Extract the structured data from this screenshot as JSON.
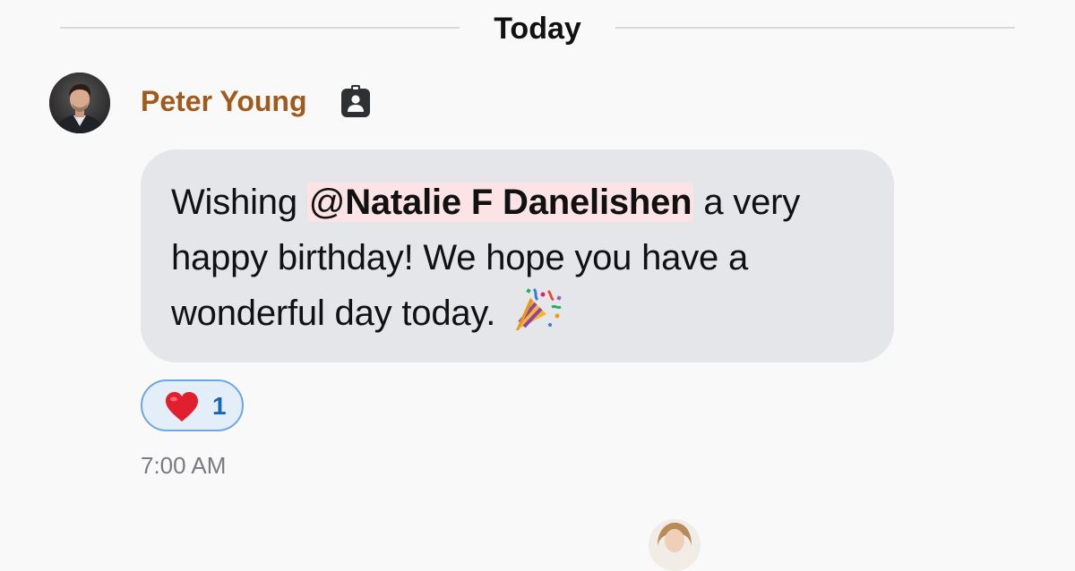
{
  "divider": {
    "label": "Today"
  },
  "message": {
    "sender": "Peter Young",
    "avatar_icon": "user-avatar",
    "badge_icon": "contact-card-icon",
    "text_before": "Wishing ",
    "mention_at": "@",
    "mention_name": "Natalie F Danelishen",
    "text_after": " a very happy birthday! We hope you have a wonderful day today. ",
    "emoji_icon": "party-popper-icon",
    "reaction": {
      "emoji_icon": "red-heart-icon",
      "count": "1"
    },
    "time": "7:00 AM"
  },
  "colors": {
    "sender": "#a25a1c",
    "bubble": "#e5e6ea",
    "mention_bg": "#fbe3e6",
    "reaction_border": "#6aa7e6",
    "reaction_bg": "#e4eef9",
    "reaction_count": "#1565c0",
    "timestamp": "#7a7a80"
  }
}
